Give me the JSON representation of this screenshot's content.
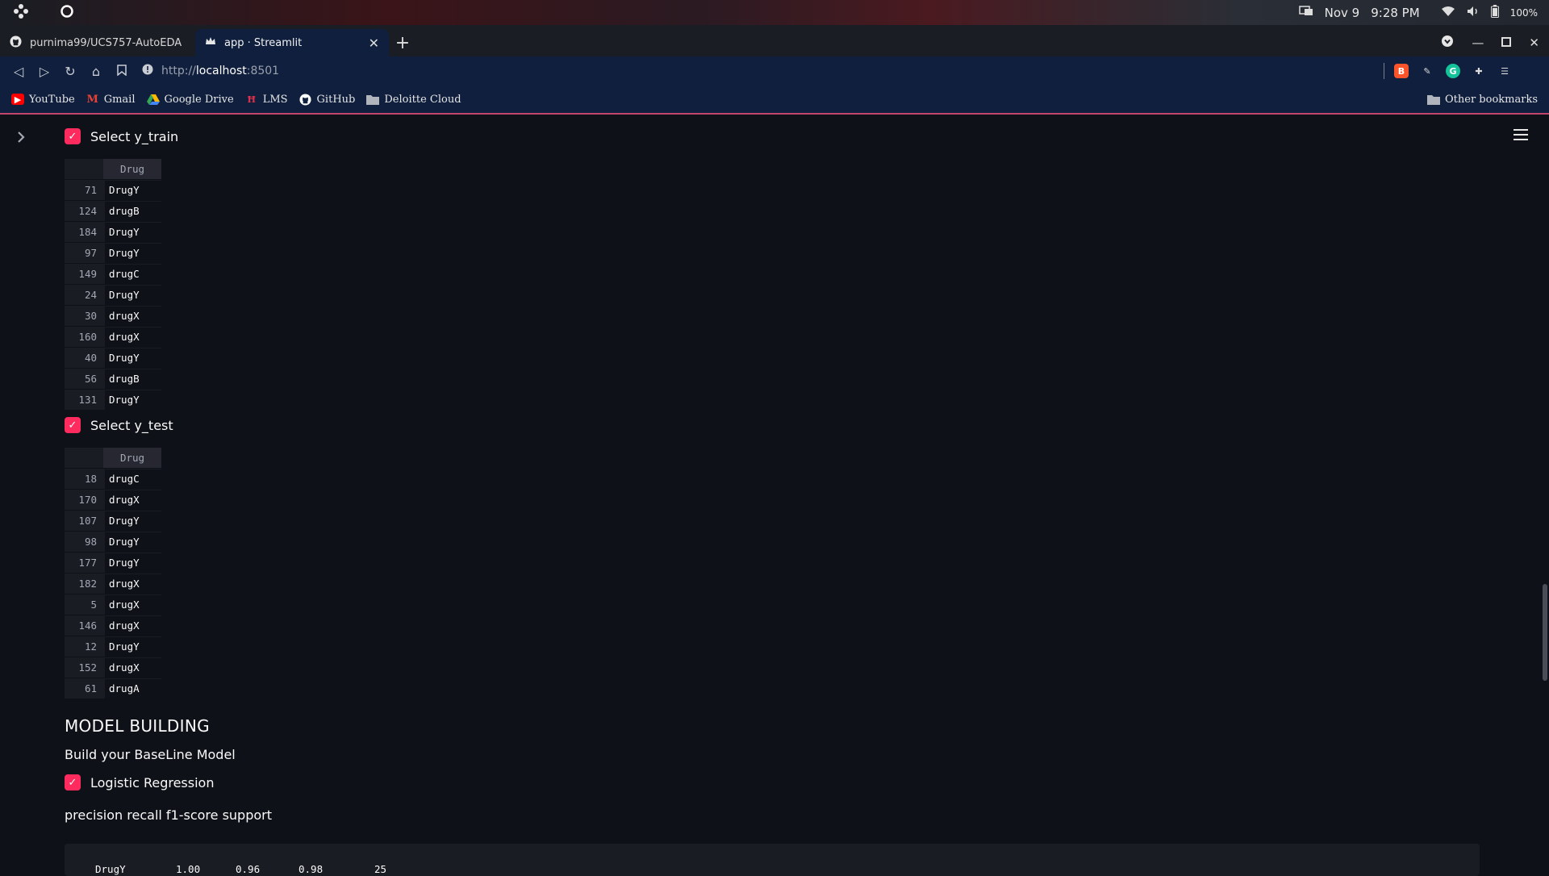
{
  "os_bar": {
    "date": "Nov 9",
    "time": "9:28 PM",
    "battery": "100%"
  },
  "tabs": [
    {
      "label": "purnima99/UCS757-AutoEDA",
      "active": false
    },
    {
      "label": "app · Streamlit",
      "active": true
    }
  ],
  "address_bar": {
    "protocol": "http://",
    "host": "localhost",
    "port": ":8501"
  },
  "bookmarks": [
    {
      "label": "YouTube",
      "icon": "youtube-icon",
      "color": "#ff0000"
    },
    {
      "label": "Gmail",
      "icon": "gmail-icon",
      "color": "#ea4335"
    },
    {
      "label": "Google Drive",
      "icon": "drive-icon",
      "color": "#34a853"
    },
    {
      "label": "LMS",
      "icon": "lms-icon",
      "color": "#e0314b"
    },
    {
      "label": "GitHub",
      "icon": "github-icon",
      "color": "#ffffff"
    },
    {
      "label": "Deloitte Cloud",
      "icon": "folder-icon",
      "color": "#b0b4bc"
    }
  ],
  "other_bookmarks": "Other bookmarks",
  "app": {
    "accent": "#ff2b5e",
    "y_train": {
      "checkbox_label": "Select y_train",
      "column": "Drug",
      "rows": [
        {
          "index": "71",
          "value": "DrugY"
        },
        {
          "index": "124",
          "value": "drugB"
        },
        {
          "index": "184",
          "value": "DrugY"
        },
        {
          "index": "97",
          "value": "DrugY"
        },
        {
          "index": "149",
          "value": "drugC"
        },
        {
          "index": "24",
          "value": "DrugY"
        },
        {
          "index": "30",
          "value": "drugX"
        },
        {
          "index": "160",
          "value": "drugX"
        },
        {
          "index": "40",
          "value": "DrugY"
        },
        {
          "index": "56",
          "value": "drugB"
        },
        {
          "index": "131",
          "value": "DrugY"
        }
      ]
    },
    "y_test": {
      "checkbox_label": "Select y_test",
      "column": "Drug",
      "rows": [
        {
          "index": "18",
          "value": "drugC"
        },
        {
          "index": "170",
          "value": "drugX"
        },
        {
          "index": "107",
          "value": "DrugY"
        },
        {
          "index": "98",
          "value": "DrugY"
        },
        {
          "index": "177",
          "value": "DrugY"
        },
        {
          "index": "182",
          "value": "drugX"
        },
        {
          "index": "5",
          "value": "drugX"
        },
        {
          "index": "146",
          "value": "drugX"
        },
        {
          "index": "12",
          "value": "DrugY"
        },
        {
          "index": "152",
          "value": "drugX"
        },
        {
          "index": "61",
          "value": "drugA"
        }
      ]
    },
    "model_building": {
      "heading": "MODEL BUILDING",
      "subtitle": "Build your BaseLine Model",
      "checkbox_label": "Logistic Regression",
      "report_header": "precision recall f1-score support",
      "report_row": {
        "label": "DrugY",
        "precision": "1.00",
        "recall": "0.96",
        "f1": "0.98",
        "support": "25"
      }
    }
  }
}
